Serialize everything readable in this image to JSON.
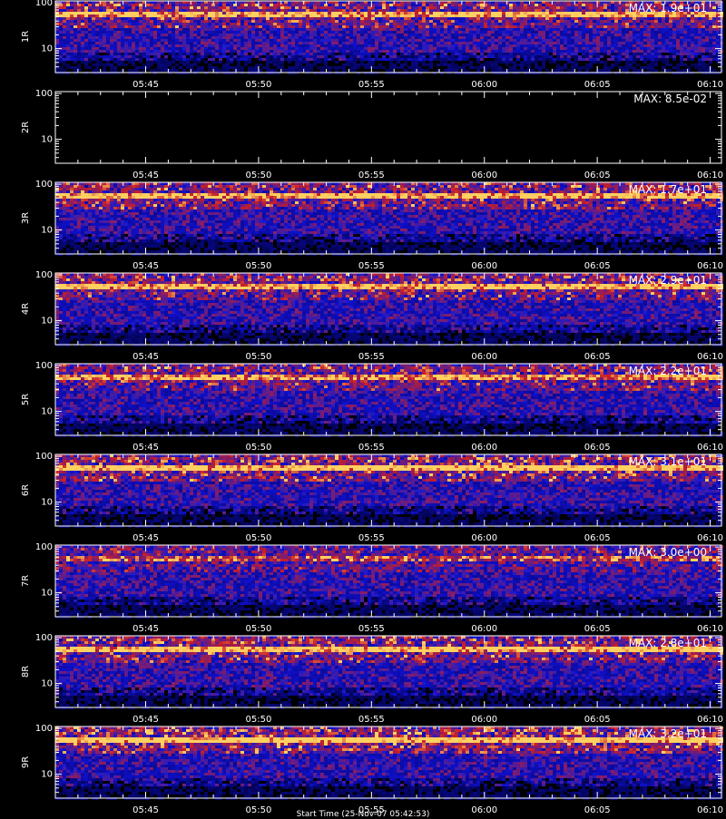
{
  "figure": {
    "time_axis_title": "Start Time (25-Nov-07 05:42:53)"
  },
  "chart_data": [
    {
      "type": "heatmap",
      "panel": "1R",
      "ylabel": "1R",
      "max_label": "MAX: 1.9e+01",
      "yticks": [
        10,
        100
      ],
      "ylim": [
        3,
        110
      ],
      "xlim": [
        "05:41",
        "06:10:30"
      ],
      "xticks": [
        "05:45",
        "05:50",
        "05:55",
        "06:00",
        "06:05",
        "06:10"
      ],
      "band_freq": 60,
      "empty": false,
      "band_strength": 0.75
    },
    {
      "type": "heatmap",
      "panel": "2R",
      "ylabel": "2R",
      "max_label": "MAX: 8.5e-02",
      "yticks": [
        10,
        100
      ],
      "ylim": [
        3,
        110
      ],
      "xlim": [
        "05:41",
        "06:10:30"
      ],
      "xticks": [
        "05:45",
        "05:50",
        "05:55",
        "06:00",
        "06:05",
        "06:10"
      ],
      "band_freq": 60,
      "empty": true,
      "band_strength": 0
    },
    {
      "type": "heatmap",
      "panel": "3R",
      "ylabel": "3R",
      "max_label": "MAX: 1.7e+01",
      "yticks": [
        10,
        100
      ],
      "ylim": [
        3,
        110
      ],
      "xlim": [
        "05:41",
        "06:10:30"
      ],
      "xticks": [
        "05:45",
        "05:50",
        "05:55",
        "06:00",
        "06:05",
        "06:10"
      ],
      "band_freq": 60,
      "empty": false,
      "band_strength": 0.8
    },
    {
      "type": "heatmap",
      "panel": "4R",
      "ylabel": "4R",
      "max_label": "MAX: 2.9e+01",
      "yticks": [
        10,
        100
      ],
      "ylim": [
        3,
        110
      ],
      "xlim": [
        "05:41",
        "06:10:30"
      ],
      "xticks": [
        "05:45",
        "05:50",
        "05:55",
        "06:00",
        "06:05",
        "06:10"
      ],
      "band_freq": 60,
      "empty": false,
      "band_strength": 0.8
    },
    {
      "type": "heatmap",
      "panel": "5R",
      "ylabel": "5R",
      "max_label": "MAX: 2.2e+01",
      "yticks": [
        10,
        100
      ],
      "ylim": [
        3,
        110
      ],
      "xlim": [
        "05:41",
        "06:10:30"
      ],
      "xticks": [
        "05:45",
        "05:50",
        "05:55",
        "06:00",
        "06:05",
        "06:10"
      ],
      "band_freq": 60,
      "empty": false,
      "band_strength": 0.7
    },
    {
      "type": "heatmap",
      "panel": "6R",
      "ylabel": "6R",
      "max_label": "MAX: 3.1e+01",
      "yticks": [
        10,
        100
      ],
      "ylim": [
        3,
        110
      ],
      "xlim": [
        "05:41",
        "06:10:30"
      ],
      "xticks": [
        "05:45",
        "05:50",
        "05:55",
        "06:00",
        "06:05",
        "06:10"
      ],
      "band_freq": 60,
      "empty": false,
      "band_strength": 0.9
    },
    {
      "type": "heatmap",
      "panel": "7R",
      "ylabel": "7R",
      "max_label": "MAX: 3.0e+00",
      "yticks": [
        10,
        100
      ],
      "ylim": [
        3,
        110
      ],
      "xlim": [
        "05:41",
        "06:10:30"
      ],
      "xticks": [
        "05:45",
        "05:50",
        "05:55",
        "06:00",
        "06:05",
        "06:10"
      ],
      "band_freq": 60,
      "empty": false,
      "band_strength": 0.5
    },
    {
      "type": "heatmap",
      "panel": "8R",
      "ylabel": "8R",
      "max_label": "MAX: 2.8e+01",
      "yticks": [
        10,
        100
      ],
      "ylim": [
        3,
        110
      ],
      "xlim": [
        "05:41",
        "06:10:30"
      ],
      "xticks": [
        "05:45",
        "05:50",
        "05:55",
        "06:00",
        "06:05",
        "06:10"
      ],
      "band_freq": 60,
      "empty": false,
      "band_strength": 0.85
    },
    {
      "type": "heatmap",
      "panel": "9R",
      "ylabel": "9R",
      "max_label": "MAX: 3.2e+01",
      "yticks": [
        10,
        100
      ],
      "ylim": [
        3,
        110
      ],
      "xlim": [
        "05:41",
        "06:10:30"
      ],
      "xticks": [
        "05:45",
        "05:50",
        "05:55",
        "06:00",
        "06:05",
        "06:10"
      ],
      "band_freq": 60,
      "empty": false,
      "band_strength": 0.95
    }
  ],
  "colors": {
    "background": "#000000",
    "axis": "#ffffff",
    "low": "#1a1acc",
    "mid": "#c81e28",
    "high": "#ffd060"
  }
}
